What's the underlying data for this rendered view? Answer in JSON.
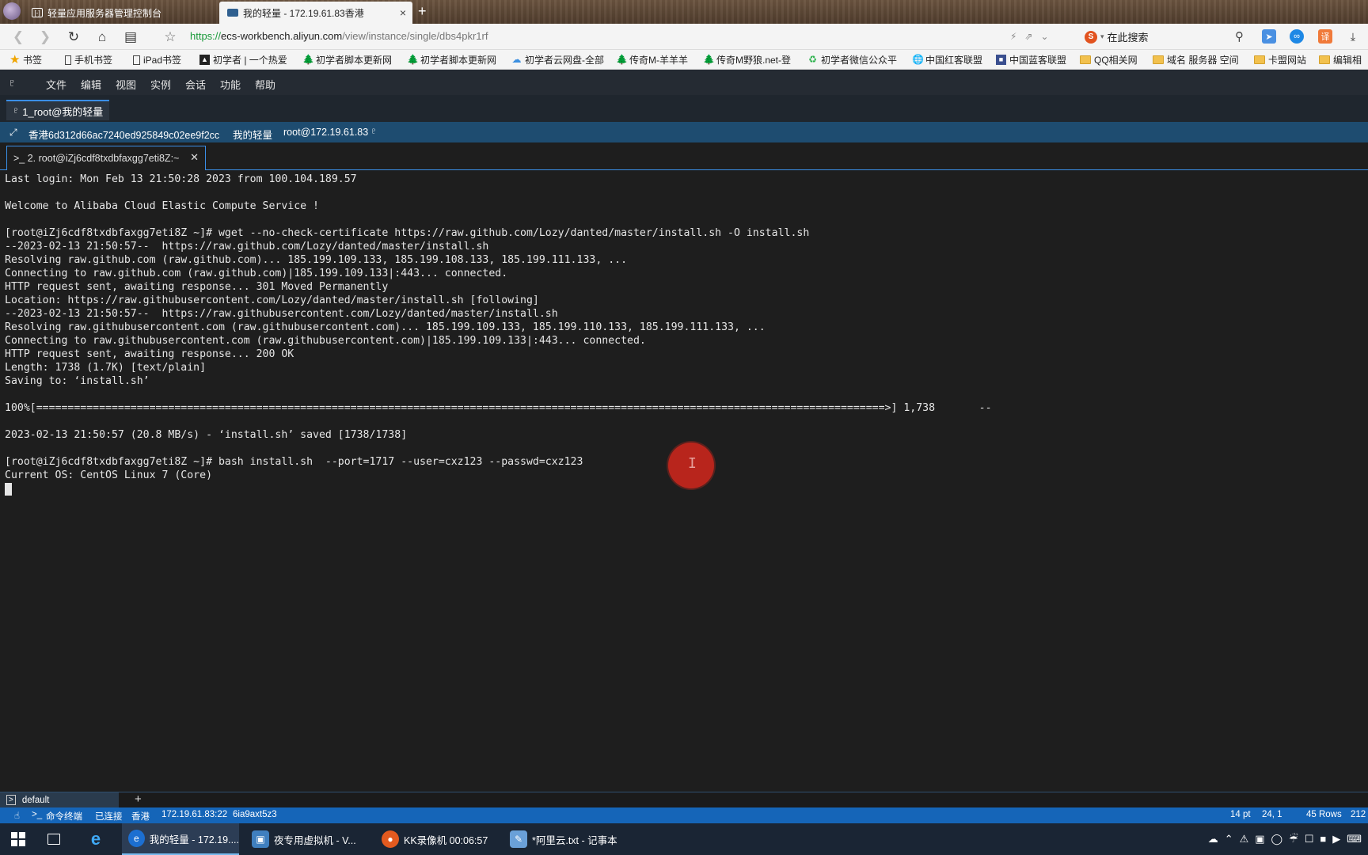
{
  "browser": {
    "tabs": [
      {
        "title": "轻量应用服务器管理控制台",
        "icon": "console-icon"
      },
      {
        "title": "我的轻量 - 172.19.61.83香港",
        "icon": "terminal-app-icon"
      }
    ],
    "url": {
      "scheme": "https://",
      "host": "ecs-workbench.aliyun.com",
      "path": "/view/instance/single/dbs4pkr1rf"
    },
    "search_placeholder": "在此搜索"
  },
  "bookmarks": [
    {
      "label": "书签",
      "icon": "star-icon"
    },
    {
      "label": "手机书签",
      "icon": "phone-icon"
    },
    {
      "label": "iPad书签",
      "icon": "tablet-icon"
    },
    {
      "label": "初学者 | 一个热爱",
      "icon": "site-icon"
    },
    {
      "label": "初学者脚本更新网",
      "icon": "tree-icon"
    },
    {
      "label": "初学者脚本更新网",
      "icon": "tree-icon"
    },
    {
      "label": "初学者云网盘-全部",
      "icon": "cloud-icon"
    },
    {
      "label": "传奇M-羊羊羊",
      "icon": "tree-icon"
    },
    {
      "label": "传奇M野狼.net-登",
      "icon": "tree-icon"
    },
    {
      "label": "初学者微信公众平",
      "icon": "wechat-icon"
    },
    {
      "label": "中国红客联盟",
      "icon": "globe-icon"
    },
    {
      "label": "中国蓝客联盟",
      "icon": "site-icon"
    },
    {
      "label": "QQ相关网",
      "icon": "folder-icon"
    },
    {
      "label": "域名 服务器 空间",
      "icon": "folder-icon"
    },
    {
      "label": "卡盟网站",
      "icon": "folder-icon"
    },
    {
      "label": "编辑相",
      "icon": "folder-icon"
    }
  ],
  "menu": [
    "文件",
    "编辑",
    "视图",
    "实例",
    "会话",
    "功能",
    "帮助"
  ],
  "session_tab": "1_root@我的轻量",
  "info": {
    "instance": "香港6d312d66ac7240ed925849c02ee9f2cc",
    "name": "我的轻量",
    "user": "root@172.19.61.83"
  },
  "terminal_tab": ">_ 2. root@iZj6cdf8txdbfaxgg7eti8Z:~",
  "terminal_lines": [
    "Last login: Mon Feb 13 21:50:28 2023 from 100.104.189.57",
    "",
    "Welcome to Alibaba Cloud Elastic Compute Service !",
    "",
    "[root@iZj6cdf8txdbfaxgg7eti8Z ~]# wget --no-check-certificate https://raw.github.com/Lozy/danted/master/install.sh -O install.sh",
    "--2023-02-13 21:50:57--  https://raw.github.com/Lozy/danted/master/install.sh",
    "Resolving raw.github.com (raw.github.com)... 185.199.109.133, 185.199.108.133, 185.199.111.133, ...",
    "Connecting to raw.github.com (raw.github.com)|185.199.109.133|:443... connected.",
    "HTTP request sent, awaiting response... 301 Moved Permanently",
    "Location: https://raw.githubusercontent.com/Lozy/danted/master/install.sh [following]",
    "--2023-02-13 21:50:57--  https://raw.githubusercontent.com/Lozy/danted/master/install.sh",
    "Resolving raw.githubusercontent.com (raw.githubusercontent.com)... 185.199.109.133, 185.199.110.133, 185.199.111.133, ...",
    "Connecting to raw.githubusercontent.com (raw.githubusercontent.com)|185.199.109.133|:443... connected.",
    "HTTP request sent, awaiting response... 200 OK",
    "Length: 1738 (1.7K) [text/plain]",
    "Saving to: ‘install.sh’",
    "",
    "100%[=======================================================================================================================================>] 1,738       --",
    "",
    "2023-02-13 21:50:57 (20.8 MB/s) - ‘install.sh’ saved [1738/1738]",
    "",
    "[root@iZj6cdf8txdbfaxgg7eti8Z ~]# bash install.sh  --port=1717 --user=cxz123 --passwd=cxz123",
    "Current OS: CentOS Linux 7 (Core)"
  ],
  "session_list": {
    "name": "default",
    "add": "+"
  },
  "status": {
    "mode": "命令终端",
    "state": "已连接",
    "region": "香港",
    "address": "172.19.61.83:22",
    "id": "6ia9axt5z3",
    "font": "14 pt",
    "cursor": "24, 1",
    "rows": "45 Rows",
    "cols": "212"
  },
  "taskbar": [
    {
      "label": "我的轻量 - 172.19....",
      "icon": "browser-icon",
      "color": "#1c6fd1"
    },
    {
      "label": "夜专用虚拟机 - V...",
      "icon": "vm-icon",
      "color": "#3f7fbf"
    },
    {
      "label": "KK录像机 00:06:57",
      "icon": "recorder-icon",
      "color": "#e35a1f"
    },
    {
      "label": "*阿里云.txt - 记事本",
      "icon": "notepad-icon",
      "color": "#6aa0d8"
    }
  ]
}
